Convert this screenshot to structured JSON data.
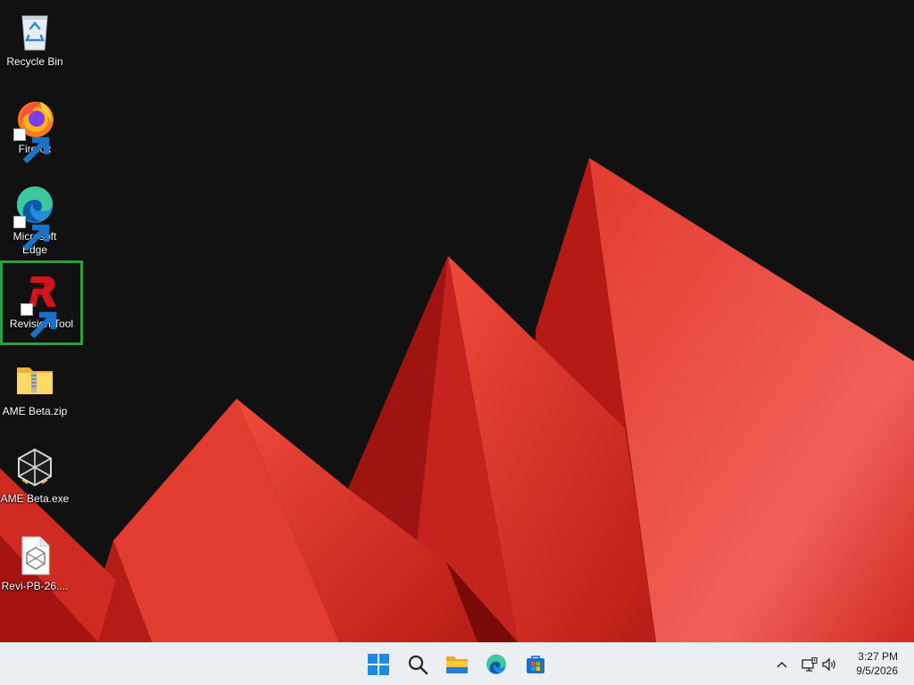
{
  "desktop": {
    "icons": [
      {
        "label": "Recycle Bin"
      },
      {
        "label": "Firefox"
      },
      {
        "label": "Microsoft Edge"
      },
      {
        "label": "Revision Tool"
      },
      {
        "label": "AME Beta.zip"
      },
      {
        "label": "AME Beta.exe"
      },
      {
        "label": "Revi-PB-26...."
      }
    ]
  },
  "taskbar": {
    "clock": {
      "time": "3:27 PM",
      "date": "9/5/2026"
    }
  },
  "colors": {
    "selection_outline": "#2ea043",
    "taskbar_bg": "#eceff1",
    "wallpaper_bg": "#111111",
    "wallpaper_red": "#e0342a"
  }
}
